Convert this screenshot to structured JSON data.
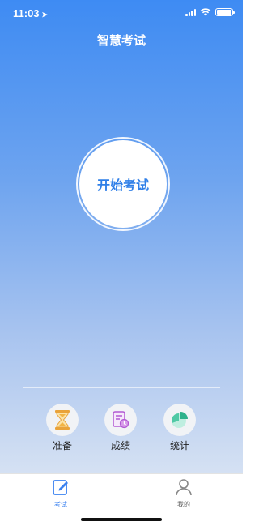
{
  "status_bar": {
    "time": "11:03"
  },
  "header": {
    "title": "智慧考试"
  },
  "main": {
    "start_button_label": "开始考试"
  },
  "features": [
    {
      "label": "准备",
      "icon": "hourglass-icon"
    },
    {
      "label": "成绩",
      "icon": "report-icon"
    },
    {
      "label": "统计",
      "icon": "pie-chart-icon"
    }
  ],
  "tabbar": {
    "tabs": [
      {
        "label": "考试",
        "icon": "edit-icon",
        "active": true
      },
      {
        "label": "我的",
        "icon": "user-icon",
        "active": false
      }
    ]
  },
  "colors": {
    "accent": "#3b82f0",
    "gradient_top": "#3e8bf3",
    "gradient_bottom": "#d5e1f3"
  }
}
